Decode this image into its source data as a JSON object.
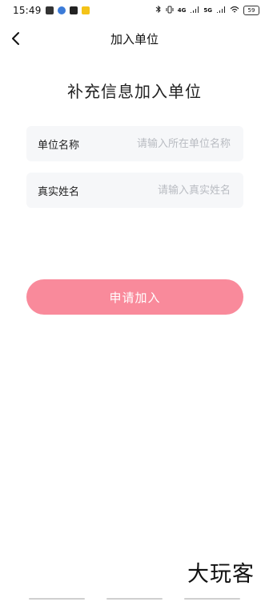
{
  "status_bar": {
    "time": "15:49",
    "signal_labels": [
      "4G",
      "5G"
    ],
    "battery": "59"
  },
  "nav": {
    "title": "加入单位"
  },
  "heading": "补充信息加入单位",
  "form": {
    "unit_name": {
      "label": "单位名称",
      "placeholder": "请输入所在单位名称",
      "value": ""
    },
    "real_name": {
      "label": "真实姓名",
      "placeholder": "请输入真实姓名",
      "value": ""
    }
  },
  "submit_label": "申请加入",
  "watermark": "大玩客",
  "colors": {
    "accent_button": "#f98a9b",
    "field_bg": "#f6f7f9",
    "placeholder": "#b9bcc2"
  }
}
